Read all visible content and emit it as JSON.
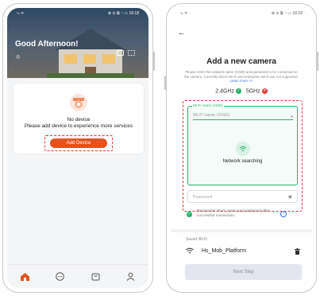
{
  "left_screen": {
    "status": {
      "left": "ⁿᵢₗ ᯤ",
      "right": "⊕ ⊙ ⧉ ◔ ▭ 16:18"
    },
    "greeting": "Good Afternoon!",
    "card": {
      "title": "No device",
      "subtitle": "Please add device to experience more services",
      "add_button": "Add Device"
    },
    "tabs": [
      "home-icon",
      "chat-icon",
      "shop-icon",
      "profile-icon"
    ],
    "accent": "#e4521e"
  },
  "right_screen": {
    "status": {
      "left": "ⁿᵢₗ ᯤ",
      "right": "⊕ ⊙ ⧉ ◔ ▭ 16:18"
    },
    "title": "Add a new camera",
    "description": "Please enter the network name (SSID) and password to be connected to the camera. Currently 5GHz Wi-Fi and enterprise Wi-Fi are not supported.",
    "learn_more": "Learn more >>",
    "band_24": "2.4GHz",
    "band_5": "5GHz",
    "wifi_legend": "Wi-Fi name (SSID)",
    "wifi_placeholder": "Wi-Fi name (SSID)",
    "searching": "Network searching",
    "password_placeholder": "Password",
    "remember": "Remember Wi-Fi name and password after successful connection.",
    "saved_label": "Saved Wi-Fi",
    "saved_ssid": "Hs_Mob_Platform",
    "next_button": "Next Step",
    "accent": "#27b36b",
    "error": "#e53935"
  }
}
